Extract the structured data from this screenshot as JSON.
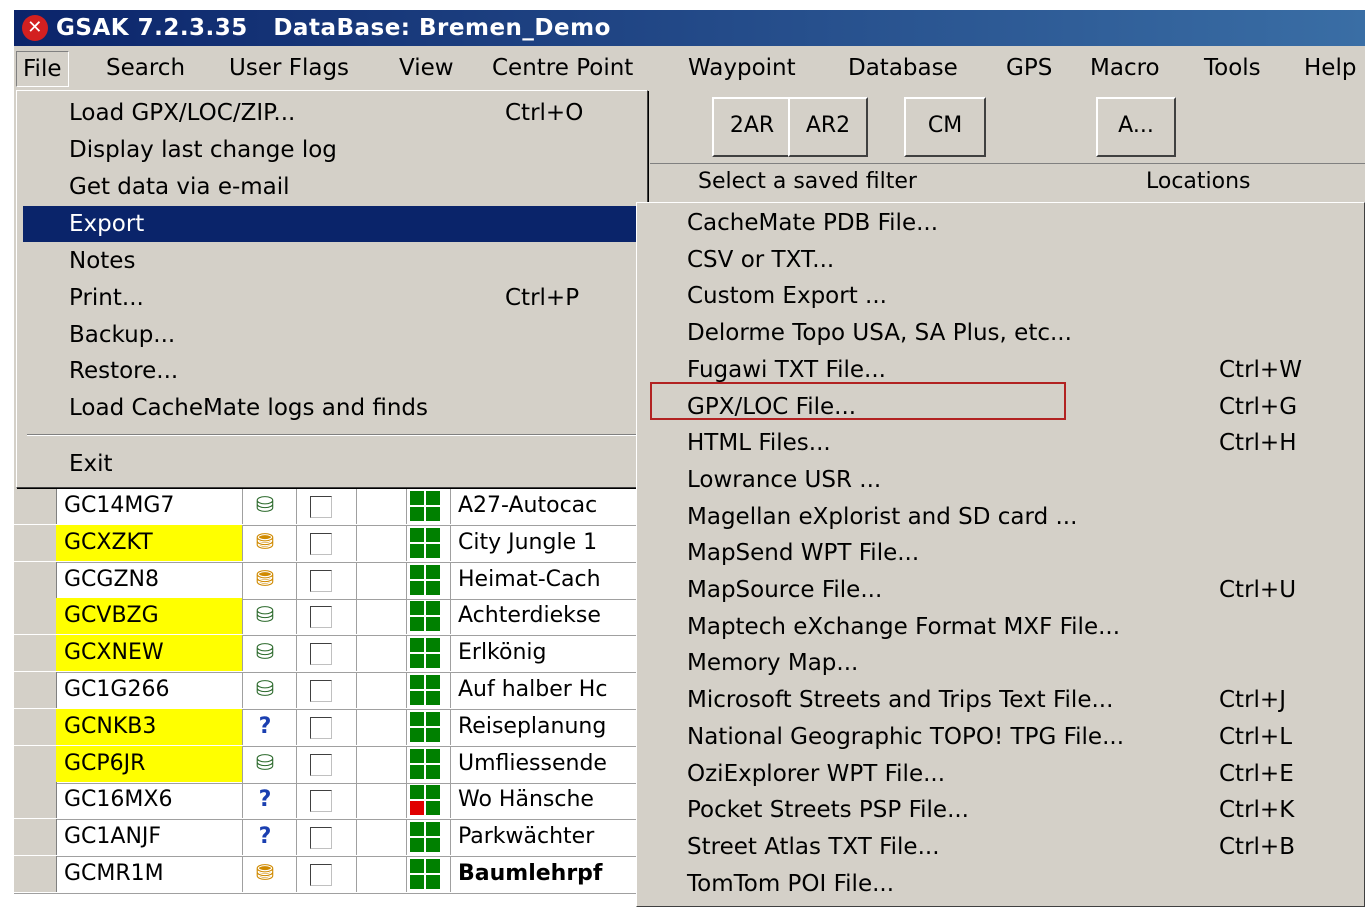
{
  "window": {
    "app_name": "GSAK 7.2.3.35",
    "database_label": "DataBase: Bremen_Demo",
    "icon": "gsak-logo-icon"
  },
  "menubar": {
    "items": [
      "File",
      "Search",
      "User Flags",
      "View",
      "Centre Point",
      "Waypoint",
      "Database",
      "GPS",
      "Macro",
      "Tools",
      "Help"
    ]
  },
  "toolbar": {
    "buttons": [
      "2AR",
      "AR2",
      "CM",
      "A..."
    ],
    "filter_label": "Select a saved filter",
    "locations_label": "Locations"
  },
  "file_menu": {
    "items": [
      {
        "label": "Load GPX/LOC/ZIP...",
        "shortcut": "Ctrl+O"
      },
      {
        "label": "Display last change log",
        "shortcut": ""
      },
      {
        "label": "Get data via e-mail",
        "shortcut": ""
      },
      {
        "label": "Export",
        "shortcut": "",
        "submenu": true
      },
      {
        "label": "Notes",
        "shortcut": "",
        "submenu": true
      },
      {
        "label": "Print...",
        "shortcut": "Ctrl+P"
      },
      {
        "label": "Backup...",
        "shortcut": ""
      },
      {
        "label": "Restore...",
        "shortcut": ""
      },
      {
        "label": "Load CacheMate logs and finds",
        "shortcut": ""
      },
      {
        "label": "Exit",
        "shortcut": ""
      }
    ],
    "active_item": "Export"
  },
  "export_menu": {
    "items": [
      {
        "label": "CacheMate PDB File...",
        "shortcut": ""
      },
      {
        "label": "CSV or TXT...",
        "shortcut": ""
      },
      {
        "label": "Custom Export ...",
        "shortcut": ""
      },
      {
        "label": "Delorme Topo USA, SA Plus, etc...",
        "shortcut": ""
      },
      {
        "label": "Fugawi TXT File...",
        "shortcut": "Ctrl+W"
      },
      {
        "label": "GPX/LOC File...",
        "shortcut": "Ctrl+G"
      },
      {
        "label": "HTML Files...",
        "shortcut": "Ctrl+H"
      },
      {
        "label": "Lowrance USR ...",
        "shortcut": ""
      },
      {
        "label": "Magellan eXplorist and SD card ...",
        "shortcut": ""
      },
      {
        "label": "MapSend WPT File...",
        "shortcut": ""
      },
      {
        "label": "MapSource File...",
        "shortcut": "Ctrl+U"
      },
      {
        "label": "Maptech eXchange Format MXF File...",
        "shortcut": ""
      },
      {
        "label": "Memory Map...",
        "shortcut": ""
      },
      {
        "label": "Microsoft Streets and Trips Text File...",
        "shortcut": "Ctrl+J"
      },
      {
        "label": "National Geographic TOPO! TPG File...",
        "shortcut": "Ctrl+L"
      },
      {
        "label": "OziExplorer WPT File...",
        "shortcut": "Ctrl+E"
      },
      {
        "label": "Pocket Streets PSP File...",
        "shortcut": "Ctrl+K"
      },
      {
        "label": "Street Atlas TXT File...",
        "shortcut": "Ctrl+B"
      },
      {
        "label": "TomTom POI File...",
        "shortcut": ""
      }
    ],
    "highlighted_item": "GPX/LOC File...",
    "highlight_color": "#b22222"
  },
  "grid": {
    "rows": [
      {
        "code": "GC14MG7",
        "highlight": false,
        "type_icon": "traditional-cache-icon",
        "status": "green",
        "name": "A27-Autocac",
        "bold": false
      },
      {
        "code": "GCXZKT",
        "highlight": true,
        "type_icon": "multi-cache-icon",
        "status": "green",
        "name": "City Jungle 1",
        "bold": false
      },
      {
        "code": "GCGZN8",
        "highlight": false,
        "type_icon": "multi-cache-icon",
        "status": "green",
        "name": "Heimat-Cach",
        "bold": false
      },
      {
        "code": "GCVBZG",
        "highlight": true,
        "type_icon": "traditional-cache-icon",
        "status": "green",
        "name": "Achterdiekse",
        "bold": false
      },
      {
        "code": "GCXNEW",
        "highlight": true,
        "type_icon": "traditional-cache-icon",
        "status": "green",
        "name": "Erlkönig",
        "bold": false
      },
      {
        "code": "GC1G266",
        "highlight": false,
        "type_icon": "traditional-cache-icon",
        "status": "green",
        "name": "Auf halber Hc",
        "bold": false
      },
      {
        "code": "GCNKB3",
        "highlight": true,
        "type_icon": "mystery-cache-icon",
        "status": "green",
        "name": "Reiseplanung",
        "bold": false
      },
      {
        "code": "GCP6JR",
        "highlight": true,
        "type_icon": "traditional-cache-icon",
        "status": "green",
        "name": "Umfliessende",
        "bold": false
      },
      {
        "code": "GC16MX6",
        "highlight": false,
        "type_icon": "mystery-cache-icon",
        "status": "red",
        "name": "Wo Hänsche",
        "bold": false
      },
      {
        "code": "GC1ANJF",
        "highlight": false,
        "type_icon": "mystery-cache-icon",
        "status": "green",
        "name": "Parkwächter",
        "bold": false
      },
      {
        "code": "GCMR1M",
        "highlight": false,
        "type_icon": "multi-cache-icon",
        "status": "green",
        "name": "Baumlehrpf",
        "bold": true
      }
    ]
  },
  "colors": {
    "title_bar": "#0b246a",
    "menu_bg": "#d4d0c8",
    "selection": "#0a246a",
    "code_highlight": "#ffff00",
    "status_green": "#008000",
    "status_red": "#e00000"
  }
}
